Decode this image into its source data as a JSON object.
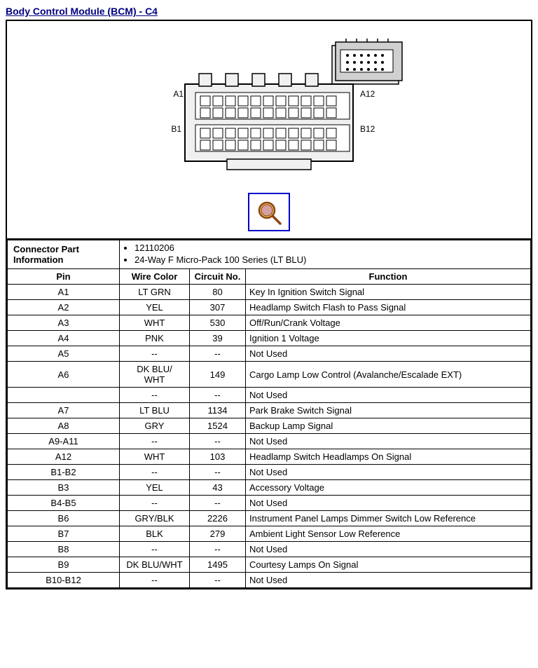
{
  "title": "Body Control Module (BCM) - C4",
  "connector_info": {
    "label": "Connector Part Information",
    "part_number": "12110206",
    "description": "24-Way F Micro-Pack 100 Series (LT BLU)"
  },
  "table_headers": {
    "pin": "Pin",
    "wire_color": "Wire Color",
    "circuit_no": "Circuit No.",
    "function": "Function"
  },
  "rows": [
    {
      "pin": "A1",
      "wire": "LT GRN",
      "circuit": "80",
      "function": "Key In Ignition Switch Signal"
    },
    {
      "pin": "A2",
      "wire": "YEL",
      "circuit": "307",
      "function": "Headlamp Switch Flash to Pass Signal"
    },
    {
      "pin": "A3",
      "wire": "WHT",
      "circuit": "530",
      "function": "Off/Run/Crank Voltage"
    },
    {
      "pin": "A4",
      "wire": "PNK",
      "circuit": "39",
      "function": "Ignition 1 Voltage"
    },
    {
      "pin": "A5",
      "wire": "--",
      "circuit": "--",
      "function": "Not Used"
    },
    {
      "pin": "A6",
      "wire": "DK BLU/\nWHT",
      "circuit": "149",
      "function": "Cargo Lamp Low Control (Avalanche/Escalade EXT)"
    },
    {
      "pin": "",
      "wire": "--",
      "circuit": "--",
      "function": "Not Used"
    },
    {
      "pin": "A7",
      "wire": "LT BLU",
      "circuit": "1134",
      "function": "Park Brake Switch Signal"
    },
    {
      "pin": "A8",
      "wire": "GRY",
      "circuit": "1524",
      "function": "Backup Lamp Signal"
    },
    {
      "pin": "A9-A11",
      "wire": "--",
      "circuit": "--",
      "function": "Not Used"
    },
    {
      "pin": "A12",
      "wire": "WHT",
      "circuit": "103",
      "function": "Headlamp Switch Headlamps On Signal"
    },
    {
      "pin": "B1-B2",
      "wire": "--",
      "circuit": "--",
      "function": "Not Used"
    },
    {
      "pin": "B3",
      "wire": "YEL",
      "circuit": "43",
      "function": "Accessory Voltage"
    },
    {
      "pin": "B4-B5",
      "wire": "--",
      "circuit": "--",
      "function": "Not Used"
    },
    {
      "pin": "B6",
      "wire": "GRY/BLK",
      "circuit": "2226",
      "function": "Instrument Panel Lamps Dimmer Switch Low Reference"
    },
    {
      "pin": "B7",
      "wire": "BLK",
      "circuit": "279",
      "function": "Ambient Light Sensor Low Reference"
    },
    {
      "pin": "B8",
      "wire": "--",
      "circuit": "--",
      "function": "Not Used"
    },
    {
      "pin": "B9",
      "wire": "DK BLU/WHT",
      "circuit": "1495",
      "function": "Courtesy Lamps On Signal"
    },
    {
      "pin": "B10-B12",
      "wire": "--",
      "circuit": "--",
      "function": "Not Used"
    }
  ]
}
